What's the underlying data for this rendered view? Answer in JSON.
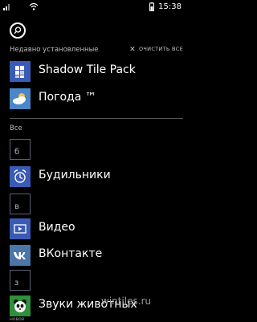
{
  "status_bar": {
    "time": "15:38",
    "icons": [
      "signal-icon",
      "wifi-icon",
      "battery-icon"
    ]
  },
  "search": {
    "icon": "search-icon"
  },
  "recent": {
    "header": "Недавно установленные",
    "clear_all": "ОЧИСТИТЬ ВСЕ",
    "apps": [
      {
        "name": "Shadow Tile Pack",
        "icon": "tile-pack-icon"
      },
      {
        "name": "Погода ™",
        "icon": "weather-icon"
      }
    ]
  },
  "all": {
    "header": "Все",
    "groups": [
      {
        "letter": "б",
        "apps": [
          {
            "name": "Будильники",
            "icon": "alarm-clock-icon"
          }
        ]
      },
      {
        "letter": "в",
        "apps": [
          {
            "name": "Видео",
            "icon": "video-icon"
          },
          {
            "name": "ВКонтакте",
            "icon": "vk-icon"
          }
        ]
      },
      {
        "letter": "з",
        "apps": [
          {
            "name": "Звуки животных",
            "icon": "panda-icon",
            "badge": "новое"
          }
        ]
      }
    ]
  },
  "watermark": "wintiles.ru",
  "colors": {
    "background": "#000000",
    "accent": "#3a5bb5",
    "letter_border": "#5a6170"
  }
}
